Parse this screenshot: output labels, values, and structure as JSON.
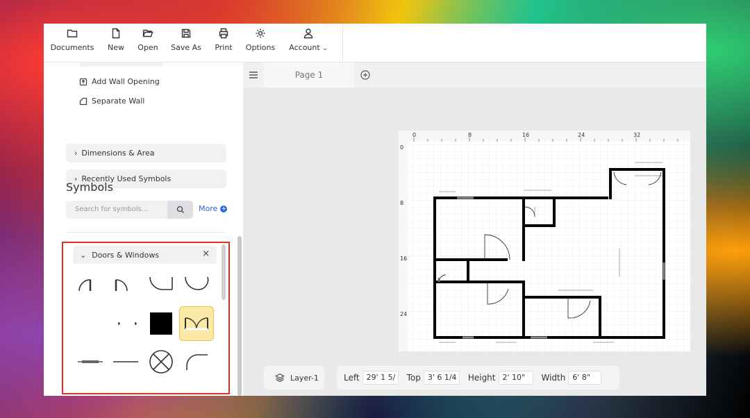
{
  "toolbar": {
    "items": [
      {
        "label": "Documents",
        "icon": "folder-icon"
      },
      {
        "label": "New",
        "icon": "file-icon"
      },
      {
        "label": "Open",
        "icon": "folder-open-icon"
      },
      {
        "label": "Save As",
        "icon": "save-icon"
      },
      {
        "label": "Print",
        "icon": "printer-icon"
      },
      {
        "label": "Options",
        "icon": "gear-icon"
      },
      {
        "label": "Account",
        "icon": "user-icon"
      }
    ]
  },
  "sidebar": {
    "items": [
      {
        "label": "Add Wall Opening",
        "icon": "wall-opening-icon"
      },
      {
        "label": "Separate Wall",
        "icon": "separate-wall-icon"
      }
    ],
    "accordions": [
      {
        "label": "Dimensions & Area"
      },
      {
        "label": "Recently Used Symbols"
      }
    ],
    "symbols_title": "Symbols",
    "search_placeholder": "Search for symbols...",
    "more_label": "More",
    "library": {
      "title": "Doors & Windows",
      "close_symbol": "×",
      "symbols": [
        "door-left-swing",
        "door-right-swing",
        "door-bottom-left",
        "door-bottom-right",
        "door-small-marks",
        "black-square",
        "double-door-selected",
        "window-line-thick",
        "window-line-thin",
        "circle-x",
        "arc-door"
      ]
    }
  },
  "canvas": {
    "page_tab": "Page 1",
    "ruler_labels": [
      "0",
      "8",
      "16",
      "24",
      "32"
    ],
    "left_ruler_labels": [
      "0",
      "8",
      "16",
      "24"
    ]
  },
  "bottom_bar": {
    "layer": "Layer-1",
    "left_label": "Left",
    "left_value": "29' 1 5/",
    "top_label": "Top",
    "top_value": "3' 6 1/4",
    "height_label": "Height",
    "height_value": "2' 10\"",
    "width_label": "Width",
    "width_value": "6' 8\""
  },
  "colors": {
    "accent": "#2a6ad8",
    "highlight_box": "#e0301e",
    "selected_symbol": "#fbe9a6"
  }
}
